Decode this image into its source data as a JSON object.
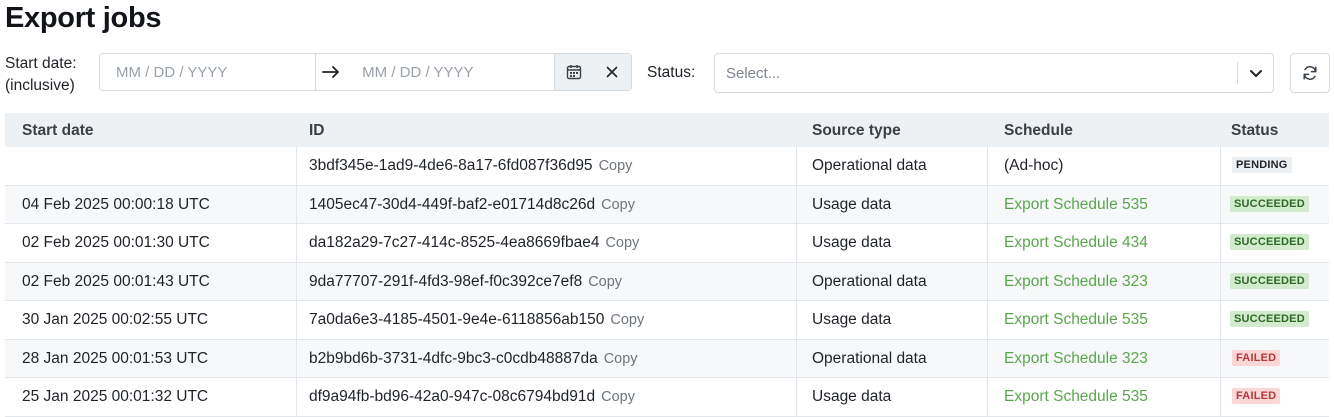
{
  "page": {
    "title": "Export jobs"
  },
  "filters": {
    "start_date_label_line1": "Start date:",
    "start_date_label_line2": "(inclusive)",
    "start_placeholder": "MM / DD / YYYY",
    "end_placeholder": "MM / DD / YYYY",
    "status_label": "Status:",
    "status_placeholder": "Select..."
  },
  "table": {
    "columns": {
      "start_date": "Start date",
      "id": "ID",
      "source_type": "Source type",
      "schedule": "Schedule",
      "status": "Status"
    },
    "copy_label": "Copy",
    "rows": [
      {
        "start_date": "",
        "id": "3bdf345e-1ad9-4de6-8a17-6fd087f36d95",
        "source_type": "Operational data",
        "schedule": "(Ad-hoc)",
        "schedule_link": false,
        "status": "PENDING"
      },
      {
        "start_date": "04 Feb 2025 00:00:18 UTC",
        "id": "1405ec47-30d4-449f-baf2-e01714d8c26d",
        "source_type": "Usage data",
        "schedule": "Export Schedule 535",
        "schedule_link": true,
        "status": "SUCCEEDED"
      },
      {
        "start_date": "02 Feb 2025 00:01:30 UTC",
        "id": "da182a29-7c27-414c-8525-4ea8669fbae4",
        "source_type": "Usage data",
        "schedule": "Export Schedule 434",
        "schedule_link": true,
        "status": "SUCCEEDED"
      },
      {
        "start_date": "02 Feb 2025 00:01:43 UTC",
        "id": "9da77707-291f-4fd3-98ef-f0c392ce7ef8",
        "source_type": "Operational data",
        "schedule": "Export Schedule 323",
        "schedule_link": true,
        "status": "SUCCEEDED"
      },
      {
        "start_date": "30 Jan 2025 00:02:55 UTC",
        "id": "7a0da6e3-4185-4501-9e4e-6118856ab150",
        "source_type": "Usage data",
        "schedule": "Export Schedule 535",
        "schedule_link": true,
        "status": "SUCCEEDED"
      },
      {
        "start_date": "28 Jan 2025 00:01:53 UTC",
        "id": "b2b9bd6b-3731-4dfc-9bc3-c0cdb48887da",
        "source_type": "Operational data",
        "schedule": "Export Schedule 323",
        "schedule_link": true,
        "status": "FAILED"
      },
      {
        "start_date": "25 Jan 2025 00:01:32 UTC",
        "id": "df9a94fb-bd96-42a0-947c-08c6794bd91d",
        "source_type": "Usage data",
        "schedule": "Export Schedule 535",
        "schedule_link": true,
        "status": "FAILED"
      }
    ]
  },
  "colors": {
    "link": "#5aa64c",
    "succeeded_bg": "#d2ebcd",
    "failed_bg": "#fad6d6",
    "pending_bg": "#edf0f3"
  },
  "icons": {
    "arrow": "arrow-right-icon",
    "calendar": "calendar-icon",
    "clear": "close-icon",
    "dropdown": "chevron-down-icon",
    "refresh": "refresh-icon"
  }
}
